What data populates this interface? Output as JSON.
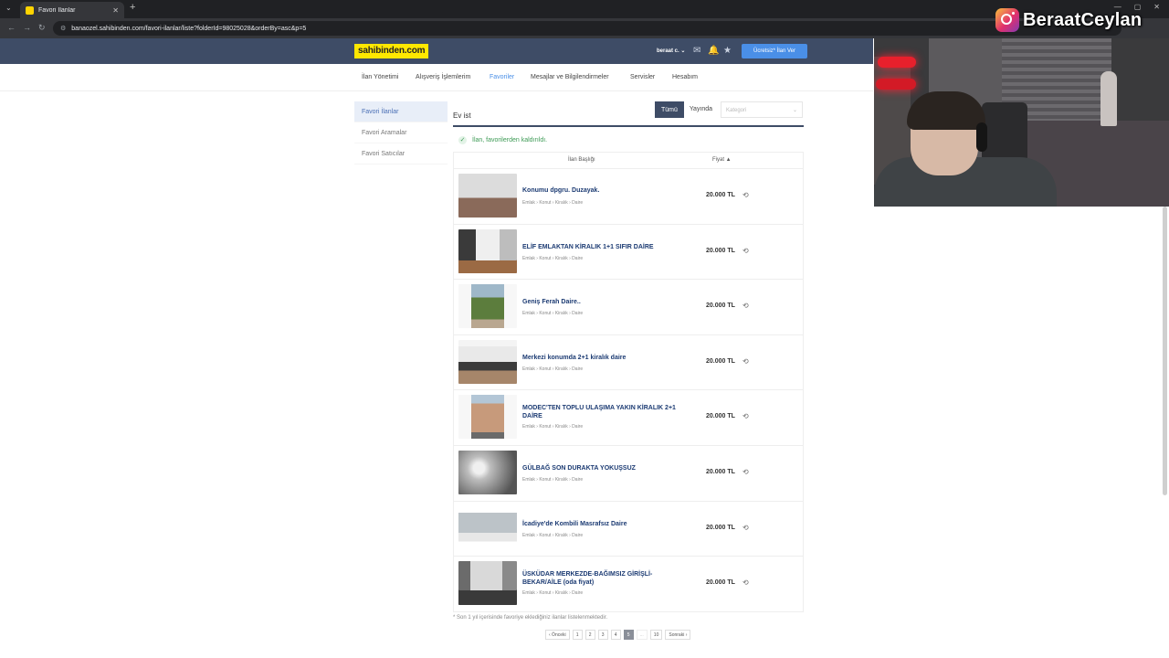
{
  "browser": {
    "tab_title": "Favori İlanlar",
    "url": "banaozel.sahibinden.com/favori-ilanlar/liste?folderId=98025028&orderBy=asc&p=5"
  },
  "header": {
    "logo": "sahibinden.com",
    "user": "beraat c.",
    "post_button": "Ücretsiz* İlan Ver"
  },
  "subnav": [
    "İlan Yönetimi",
    "Alışveriş İşlemlerim",
    "Favoriler",
    "Mesajlar ve Bilgilendirmeler",
    "Servisler",
    "Hesabım"
  ],
  "sidebar": [
    "Favori İlanlar",
    "Favori Aramalar",
    "Favori Satıcılar"
  ],
  "main": {
    "title": "Ev ist",
    "filters": [
      "Tümü",
      "Yayında"
    ],
    "category_placeholder": "Kategori",
    "notice": "İlan, favorilerden kaldırıldı.",
    "col_title": "İlan Başlığı",
    "col_price": "Fiyat ▲",
    "footnote": "* Son 1 yıl içerisinde favoriye eklediğiniz ilanlar listelenmektedir.",
    "pagination": [
      "‹ Önceki",
      "1",
      "2",
      "3",
      "4",
      "5",
      "...",
      "10",
      "Sonraki ›"
    ]
  },
  "listings": [
    {
      "title": "Konumu dpgru. Duzayak.",
      "crumb": "Emlak  ›  Konut  ›  Kiralık  ›  Daire",
      "price": "20.000 TL"
    },
    {
      "title": "ELİF EMLAKTAN KİRALIK 1+1 SIFIR DAİRE",
      "crumb": "Emlak  ›  Konut  ›  Kiralık  ›  Daire",
      "price": "20.000 TL"
    },
    {
      "title": "Geniş Ferah Daire..",
      "crumb": "Emlak  ›  Konut  ›  Kiralık  ›  Daire",
      "price": "20.000 TL"
    },
    {
      "title": "Merkezi konumda 2+1 kiralık daire",
      "crumb": "Emlak  ›  Konut  ›  Kiralık  ›  Daire",
      "price": "20.000 TL"
    },
    {
      "title": "MODEC'TEN TOPLU ULAŞIMA YAKIN KİRALIK 2+1 DAİRE",
      "crumb": "Emlak  ›  Konut  ›  Kiralık  ›  Daire",
      "price": "20.000 TL"
    },
    {
      "title": "GÜLBAĞ SON DURAKTA YOKUŞSUZ",
      "crumb": "Emlak  ›  Konut  ›  Kiralık  ›  Daire",
      "price": "20.000 TL"
    },
    {
      "title": "İcadiye'de Kombili Masrafsız Daire",
      "crumb": "Emlak  ›  Konut  ›  Kiralık  ›  Daire",
      "price": "20.000 TL"
    },
    {
      "title": "ÜSKÜDAR MERKEZDE-BAĞIMSIZ GİRİŞLİ-BEKAR/AİLE (oda fiyat)",
      "crumb": "Emlak  ›  Konut  ›  Kiralık  ›  Daire",
      "price": "20.000 TL"
    }
  ],
  "overlay": {
    "brand": "BeraatCeylan"
  }
}
